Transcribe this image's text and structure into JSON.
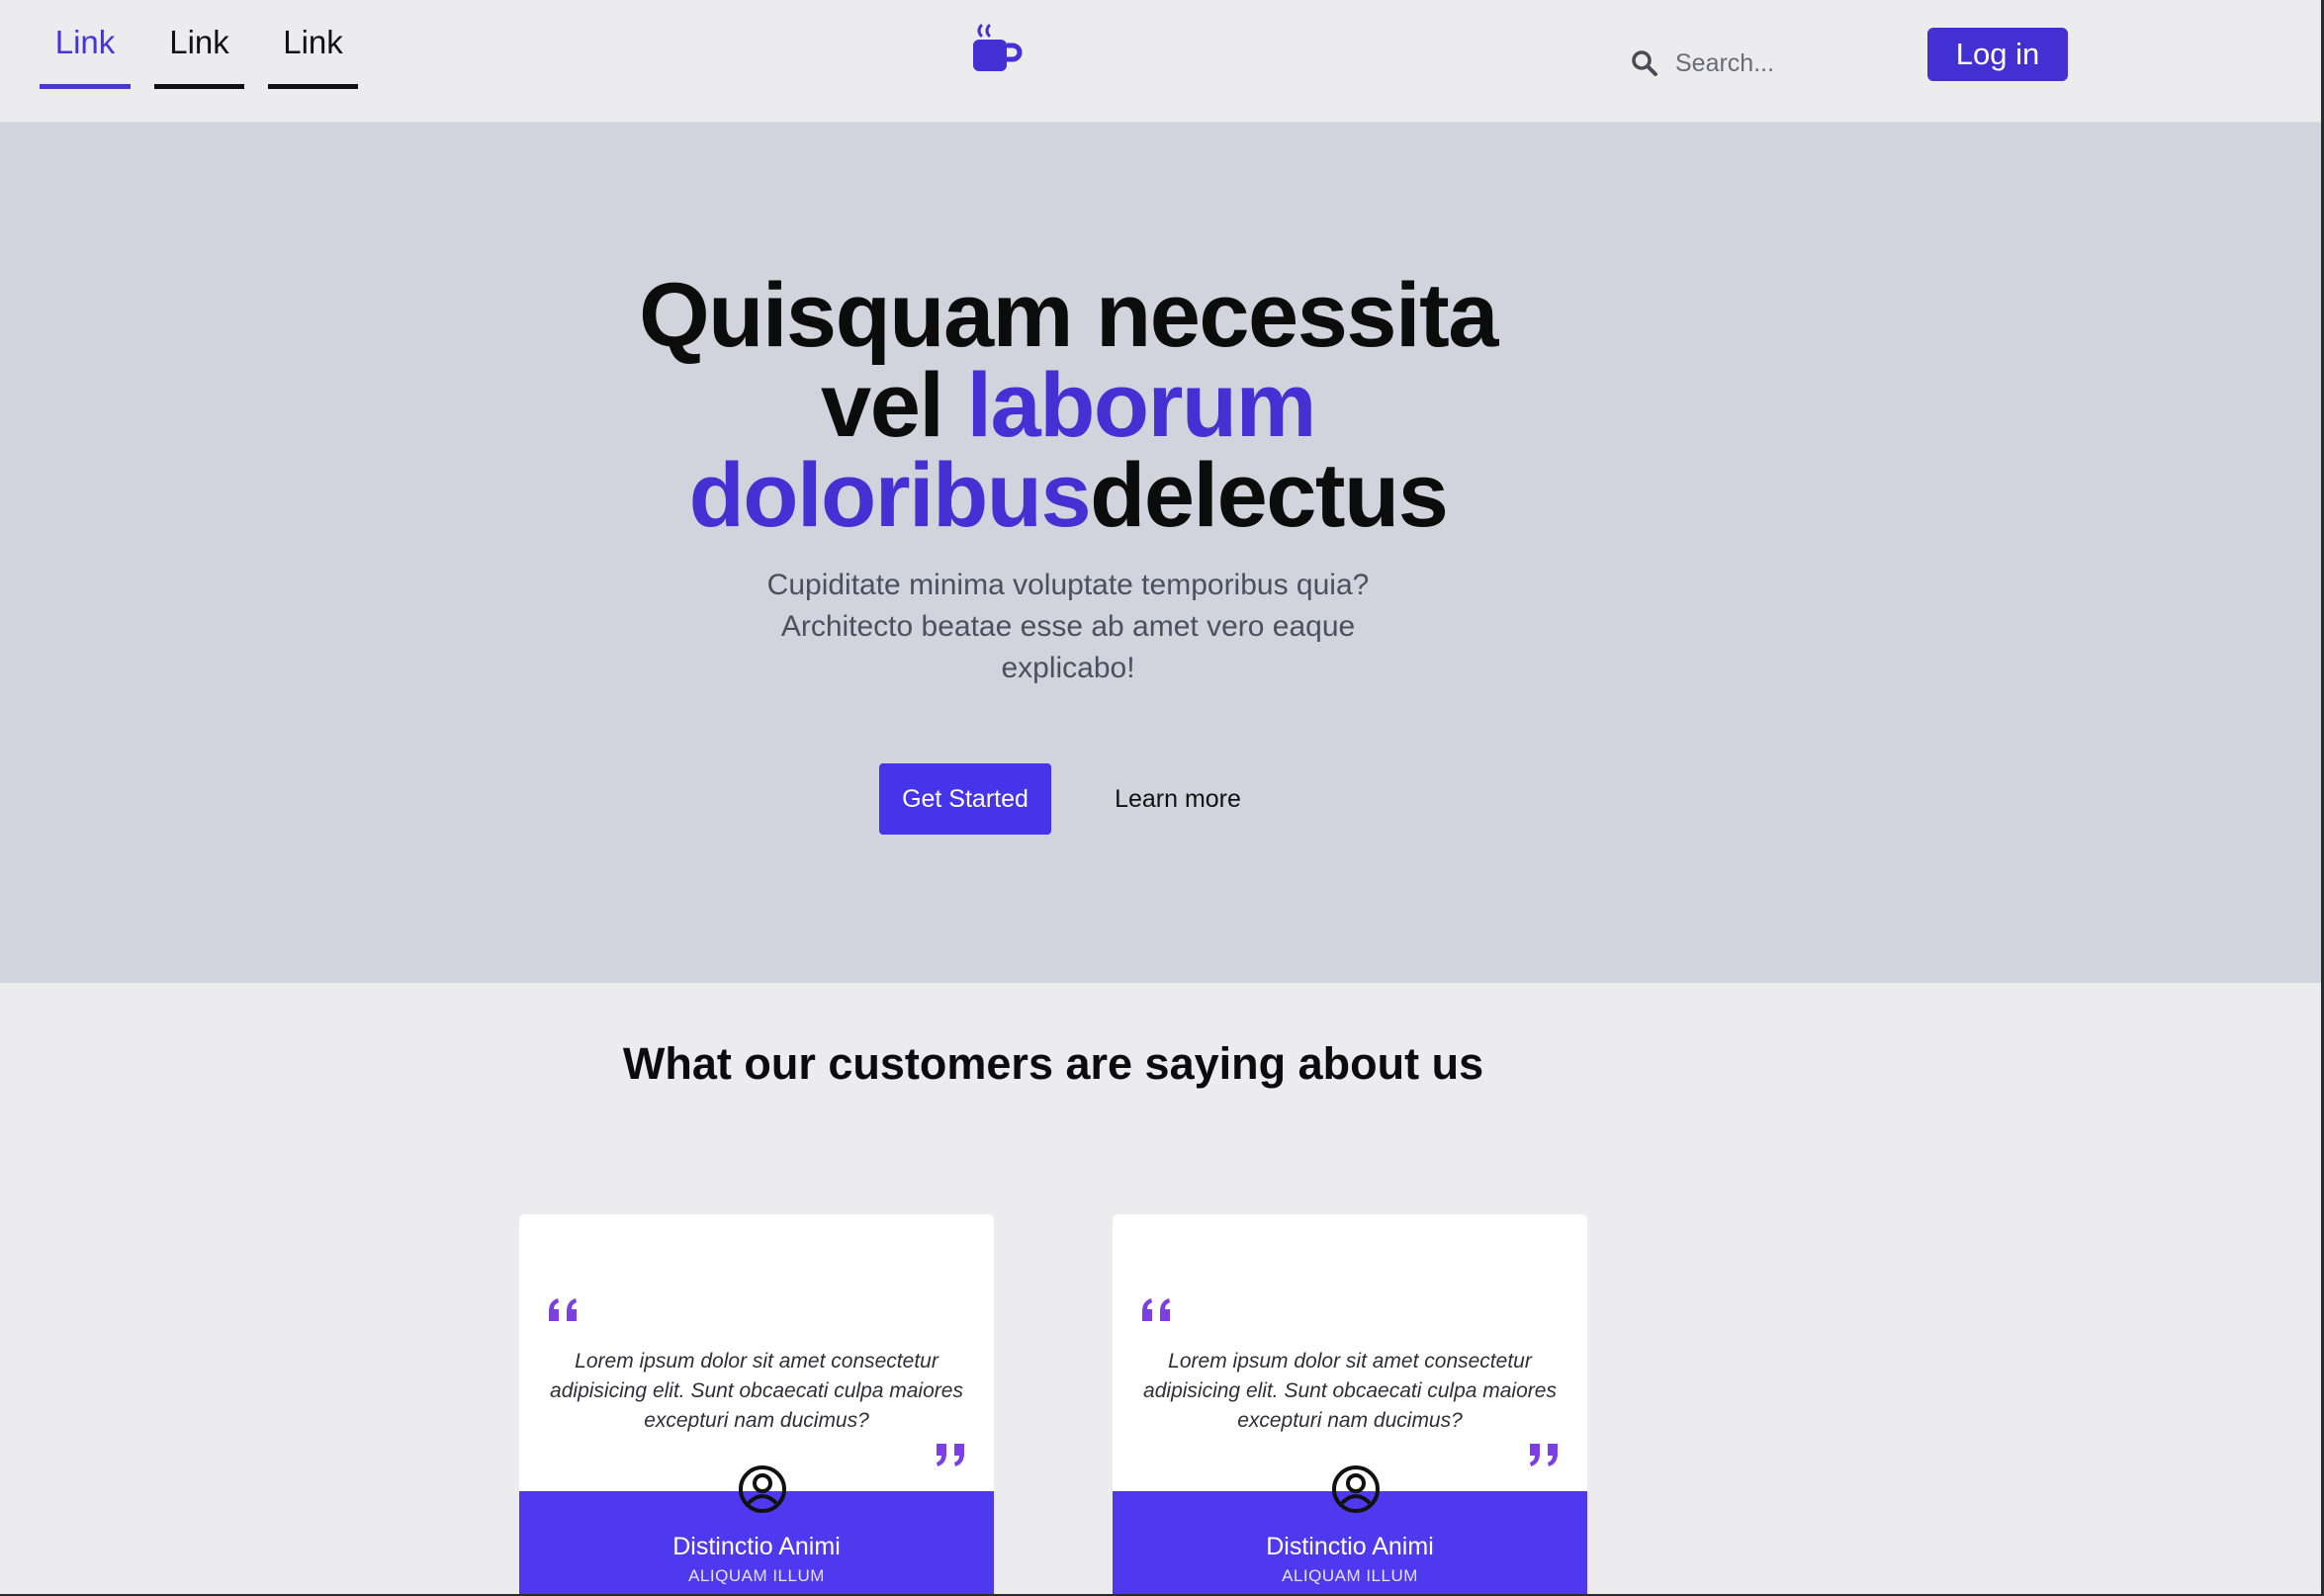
{
  "nav": {
    "links": [
      {
        "label": "Link",
        "active": true
      },
      {
        "label": "Link",
        "active": false
      },
      {
        "label": "Link",
        "active": false
      }
    ],
    "logo_icon": "coffee-cup-icon",
    "search": {
      "placeholder": "Search...",
      "icon": "search-icon"
    },
    "login_label": "Log in"
  },
  "hero": {
    "title_line1": "Quisquam necessita",
    "title_line2_plain": "vel ",
    "title_line2_accent": "laborum",
    "title_line3_accent": "doloribus",
    "title_line3_plain": "delectus",
    "subtitle": "Cupiditate minima voluptate temporibus quia? Architecto beatae esse ab amet vero eaque explicabo!",
    "primary_cta": "Get Started",
    "secondary_cta": "Learn more"
  },
  "testimonials": {
    "heading": "What our customers are saying about us",
    "items": [
      {
        "quote": "Lorem ipsum dolor sit amet consectetur adipisicing elit. Sunt obcaecati culpa maiores excepturi nam ducimus?",
        "name": "Distinctio Animi",
        "role": "ALIQUAM ILLUM"
      },
      {
        "quote": "Lorem ipsum dolor sit amet consectetur adipisicing elit. Sunt obcaecati culpa maiores excepturi nam ducimus?",
        "name": "Distinctio Animi",
        "role": "ALIQUAM ILLUM"
      }
    ]
  },
  "colors": {
    "accent": "#4530d4",
    "button": "#4634ea",
    "quote_marks": "#7b3fe4",
    "hero_bg": "#d1d4dc",
    "page_bg": "#ececef"
  }
}
